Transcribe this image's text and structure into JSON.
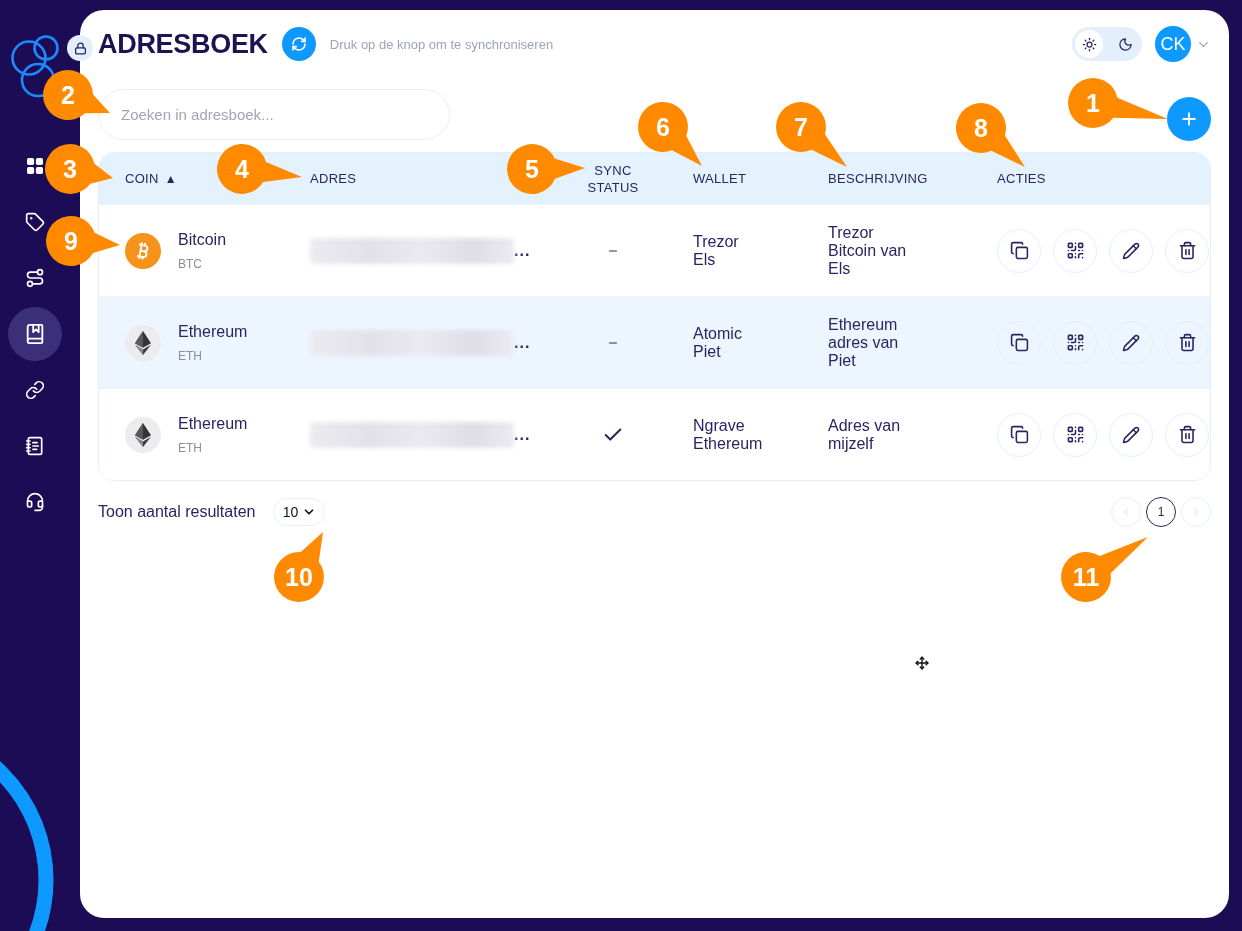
{
  "sidebar": {
    "items": [
      {
        "kind": "grid",
        "selected": false
      },
      {
        "kind": "tag",
        "selected": false
      },
      {
        "kind": "route",
        "selected": false
      },
      {
        "kind": "book",
        "selected": true
      },
      {
        "kind": "link",
        "selected": false
      },
      {
        "kind": "document",
        "selected": false
      },
      {
        "kind": "headset",
        "selected": false
      }
    ]
  },
  "header": {
    "title": "ADRESBOEK",
    "sync_hint": "Druk op de knop om te synchroniseren",
    "theme": {
      "options": [
        {
          "kind": "light",
          "selected": true
        },
        {
          "kind": "dark",
          "selected": false
        }
      ]
    },
    "user": {
      "initials": "CK"
    }
  },
  "search": {
    "placeholder": "Zoeken in adresboek..."
  },
  "table": {
    "columns": [
      {
        "label": "COIN",
        "sort_indicator": "▲"
      },
      {
        "label": "ADRES"
      },
      {
        "label": "SYNC STATUS"
      },
      {
        "label": "WALLET"
      },
      {
        "label": "BESCHRIJVING"
      },
      {
        "label": "ACTIES"
      }
    ],
    "rows": [
      {
        "coin": {
          "kind": "bitcoin",
          "name": "Bitcoin",
          "symbol": "BTC"
        },
        "address": "...",
        "synced": false,
        "wallet": "Trezor Els",
        "description": "Trezor Bitcoin van Els",
        "hovered": false
      },
      {
        "coin": {
          "kind": "ethereum",
          "name": "Ethereum",
          "symbol": "ETH"
        },
        "address": "...",
        "synced": false,
        "wallet": "Atomic Piet",
        "description": "Ethereum adres van Piet",
        "hovered": true
      },
      {
        "coin": {
          "kind": "ethereum",
          "name": "Ethereum",
          "symbol": "ETH"
        },
        "address": "...",
        "synced": true,
        "wallet": "Ngrave Ethereum",
        "description": "Adres van mijzelf",
        "hovered": false
      }
    ]
  },
  "footer": {
    "page_size_label": "Toon aantal resultaten",
    "page_size": "10",
    "previous_disabled": true,
    "next_disabled": true,
    "pages": [
      {
        "label": "1",
        "selected": true
      }
    ]
  },
  "callouts": [
    {
      "label": "1"
    },
    {
      "label": "2"
    },
    {
      "label": "3"
    },
    {
      "label": "4"
    },
    {
      "label": "5"
    },
    {
      "label": "6"
    },
    {
      "label": "7"
    },
    {
      "label": "8"
    },
    {
      "label": "9"
    },
    {
      "label": "10"
    },
    {
      "label": "11"
    }
  ]
}
